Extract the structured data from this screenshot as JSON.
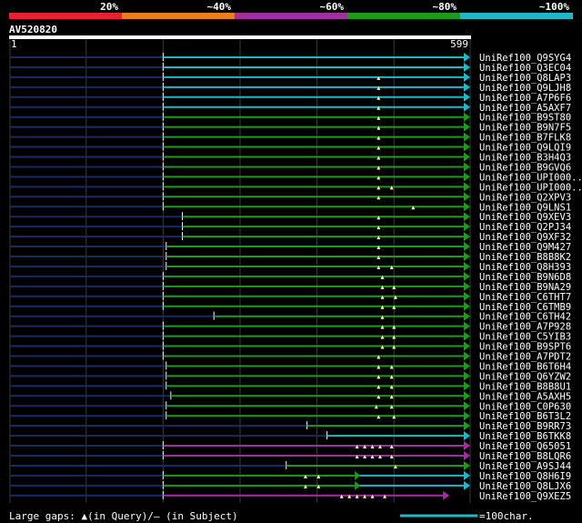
{
  "legend": {
    "segments": [
      {
        "label": "20%",
        "color": "#e8202f"
      },
      {
        "label": "~40%",
        "color": "#e87f1c"
      },
      {
        "label": "~60%",
        "color": "#a030a0"
      },
      {
        "label": "~80%",
        "color": "#1f9a1f"
      },
      {
        "label": "~100%",
        "color": "#1fb8c8"
      }
    ]
  },
  "query": {
    "name": "AV520820",
    "start_label": "1",
    "end_label": "599"
  },
  "footer": {
    "gaps_text": "Large gaps: ▲(in Query)/– (in Subject)",
    "scale_text": "=100char.",
    "scale_color": "#1fb8c8"
  },
  "chart_data": {
    "type": "alignment",
    "x_range": [
      1,
      599
    ],
    "x_ticks": [
      1,
      100,
      200,
      300,
      400,
      500,
      599
    ],
    "hits": [
      {
        "name": "UniRef100_Q9SYG4",
        "start": 200,
        "end": 599,
        "color": "#1fb8c8",
        "gaps": []
      },
      {
        "name": "UniRef100_Q3EC04",
        "start": 200,
        "end": 599,
        "color": "#1fb8c8",
        "gaps": []
      },
      {
        "name": "UniRef100_Q8LAP3",
        "start": 200,
        "end": 599,
        "color": "#1fb8c8",
        "gaps": [
          480
        ]
      },
      {
        "name": "UniRef100_Q9LJH8",
        "start": 200,
        "end": 599,
        "color": "#1fb8c8",
        "gaps": [
          480
        ]
      },
      {
        "name": "UniRef100_A7P6F6",
        "start": 200,
        "end": 599,
        "color": "#1fb8c8",
        "gaps": [
          480
        ]
      },
      {
        "name": "UniRef100_A5AXF7",
        "start": 200,
        "end": 599,
        "color": "#1fb8c8",
        "gaps": [
          480
        ]
      },
      {
        "name": "UniRef100_B9ST80",
        "start": 200,
        "end": 599,
        "color": "#1f9a1f",
        "gaps": [
          480
        ]
      },
      {
        "name": "UniRef100_B9N7F5",
        "start": 200,
        "end": 599,
        "color": "#1f9a1f",
        "gaps": [
          480
        ]
      },
      {
        "name": "UniRef100_B7FLK8",
        "start": 200,
        "end": 599,
        "color": "#1f9a1f",
        "gaps": [
          480
        ]
      },
      {
        "name": "UniRef100_Q9LQI9",
        "start": 200,
        "end": 599,
        "color": "#1f9a1f",
        "gaps": [
          480
        ]
      },
      {
        "name": "UniRef100_B3H4Q3",
        "start": 200,
        "end": 599,
        "color": "#1f9a1f",
        "gaps": [
          480
        ]
      },
      {
        "name": "UniRef100_B9GVQ6",
        "start": 200,
        "end": 599,
        "color": "#1f9a1f",
        "gaps": [
          480
        ]
      },
      {
        "name": "UniRef100_UPI000...",
        "start": 200,
        "end": 599,
        "color": "#1f9a1f",
        "gaps": [
          480
        ]
      },
      {
        "name": "UniRef100_UPI000...",
        "start": 200,
        "end": 599,
        "color": "#1f9a1f",
        "gaps": [
          480,
          497
        ]
      },
      {
        "name": "UniRef100_Q2XPV3",
        "start": 200,
        "end": 599,
        "color": "#1f9a1f",
        "gaps": [
          480
        ]
      },
      {
        "name": "UniRef100_Q9LNS1",
        "start": 200,
        "end": 599,
        "color": "#1f9a1f",
        "gaps": [
          525
        ]
      },
      {
        "name": "UniRef100_Q9XEV3",
        "start": 225,
        "end": 599,
        "color": "#1f9a1f",
        "gaps": [
          480
        ]
      },
      {
        "name": "UniRef100_Q2PJ34",
        "start": 225,
        "end": 599,
        "color": "#1f9a1f",
        "gaps": [
          480
        ]
      },
      {
        "name": "UniRef100_Q9XF32",
        "start": 225,
        "end": 599,
        "color": "#1f9a1f",
        "gaps": [
          480
        ]
      },
      {
        "name": "UniRef100_Q9M427",
        "start": 204,
        "end": 599,
        "color": "#1f9a1f",
        "gaps": [
          480
        ]
      },
      {
        "name": "UniRef100_B8B8K2",
        "start": 204,
        "end": 599,
        "color": "#1f9a1f",
        "gaps": [
          480
        ]
      },
      {
        "name": "UniRef100_Q8H393",
        "start": 204,
        "end": 599,
        "color": "#1f9a1f",
        "gaps": [
          480,
          497
        ]
      },
      {
        "name": "UniRef100_B9N6D8",
        "start": 200,
        "end": 599,
        "color": "#1f9a1f",
        "gaps": [
          485
        ]
      },
      {
        "name": "UniRef100_B9NA29",
        "start": 200,
        "end": 599,
        "color": "#1f9a1f",
        "gaps": [
          485,
          500
        ]
      },
      {
        "name": "UniRef100_C6THT7",
        "start": 200,
        "end": 599,
        "color": "#1f9a1f",
        "gaps": [
          485,
          502
        ]
      },
      {
        "name": "UniRef100_C6TMB9",
        "start": 200,
        "end": 599,
        "color": "#1f9a1f",
        "gaps": [
          485,
          500
        ]
      },
      {
        "name": "UniRef100_C6TH42",
        "start": 266,
        "end": 599,
        "color": "#1f9a1f",
        "gaps": [
          485
        ]
      },
      {
        "name": "UniRef100_A7P928",
        "start": 200,
        "end": 599,
        "color": "#1f9a1f",
        "gaps": [
          485,
          500
        ]
      },
      {
        "name": "UniRef100_C5YIB3",
        "start": 200,
        "end": 599,
        "color": "#1f9a1f",
        "gaps": [
          485,
          500
        ]
      },
      {
        "name": "UniRef100_B9SPT6",
        "start": 200,
        "end": 599,
        "color": "#1f9a1f",
        "gaps": [
          485,
          500
        ]
      },
      {
        "name": "UniRef100_A7PDT2",
        "start": 200,
        "end": 599,
        "color": "#1f9a1f",
        "gaps": [
          480
        ]
      },
      {
        "name": "UniRef100_B6T6H4",
        "start": 204,
        "end": 599,
        "color": "#1f9a1f",
        "gaps": [
          480,
          497
        ]
      },
      {
        "name": "UniRef100_Q6YZW2",
        "start": 204,
        "end": 599,
        "color": "#1f9a1f",
        "gaps": [
          480,
          497
        ]
      },
      {
        "name": "UniRef100_B8B8U1",
        "start": 204,
        "end": 599,
        "color": "#1f9a1f",
        "gaps": [
          480,
          497
        ]
      },
      {
        "name": "UniRef100_A5AXH5",
        "start": 210,
        "end": 599,
        "color": "#1f9a1f",
        "gaps": [
          480,
          497
        ]
      },
      {
        "name": "UniRef100_C0P630",
        "start": 204,
        "end": 599,
        "color": "#1f9a1f",
        "gaps": [
          477,
          497
        ]
      },
      {
        "name": "UniRef100_B6T3L2",
        "start": 204,
        "end": 599,
        "color": "#1f9a1f",
        "gaps": [
          480,
          500
        ]
      },
      {
        "name": "UniRef100_B9RR73",
        "start": 387,
        "end": 599,
        "color": "#1f9a1f",
        "gaps": []
      },
      {
        "name": "UniRef100_B6TKK8",
        "start": 413,
        "end": 599,
        "color": "#1fb8c8",
        "gaps": []
      },
      {
        "name": "UniRef100_Q65051",
        "start": 200,
        "end": 599,
        "color": "#a030a0",
        "gaps": [
          452,
          462,
          472,
          482,
          497
        ]
      },
      {
        "name": "UniRef100_B8LQR6",
        "start": 200,
        "end": 599,
        "color": "#a030a0",
        "gaps": [
          452,
          462,
          472,
          482,
          497
        ]
      },
      {
        "name": "UniRef100_A9SJ44",
        "start": 360,
        "end": 599,
        "color": "#1f9a1f",
        "gaps": [
          502
        ]
      },
      {
        "name": "UniRef100_Q8H6I9",
        "start": 200,
        "end": 455,
        "color": "#1f9a1f",
        "gaps": [
          385,
          402
        ],
        "extra": {
          "start": 455,
          "end": 599,
          "color": "#1fb8c8"
        }
      },
      {
        "name": "UniRef100_Q8LJX6",
        "start": 200,
        "end": 455,
        "color": "#1f9a1f",
        "gaps": [
          385,
          402
        ],
        "extra": {
          "start": 455,
          "end": 599,
          "color": "#1fb8c8"
        }
      },
      {
        "name": "UniRef100_Q9XEZ5",
        "start": 200,
        "end": 572,
        "color": "#a030a0",
        "gaps": [
          432,
          442,
          452,
          462,
          472,
          488
        ]
      }
    ]
  }
}
